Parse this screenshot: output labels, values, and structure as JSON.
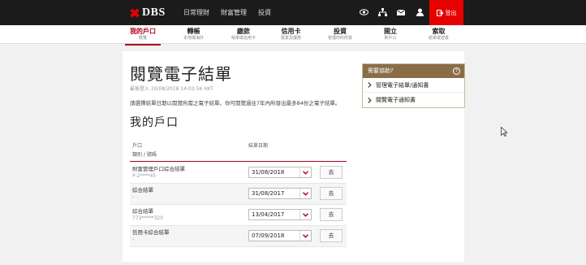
{
  "brand": "DBS",
  "topnav": [
    "日常理財",
    "財富管理",
    "投資"
  ],
  "icons": [
    "eye-icon",
    "network-icon",
    "mail-icon",
    "user-icon"
  ],
  "logout_label": "登出",
  "mainnav": [
    {
      "label": "我的戶口",
      "sub": "概覽",
      "active": true
    },
    {
      "label": "轉帳",
      "sub": "本地或海外",
      "active": false
    },
    {
      "label": "繳款",
      "sub": "賬單或信用卡",
      "active": false
    },
    {
      "label": "信用卡",
      "sub": "獎賞及優惠",
      "active": false
    },
    {
      "label": "投資",
      "sub": "管理你的財富",
      "active": false
    },
    {
      "label": "開立",
      "sub": "新戶口",
      "active": false
    },
    {
      "label": "索取",
      "sub": "結單或證書",
      "active": false
    }
  ],
  "page_title": "閱覽電子結單",
  "last_login": "最後登入 20/08/2018 14:03:56 HKT",
  "intro": "請選擇結單日期以閱覽所需之電子結單。你可閱覽過往7年內所發出最多84份之電子結單。",
  "section_title": "我的戶口",
  "columns": {
    "account": "戶口",
    "account_sub": "類別 / 號碼",
    "date": "結單日期"
  },
  "rows": [
    {
      "name": "財富管理戶口綜合結單",
      "number": "P-2****45",
      "date": "31/08/2018"
    },
    {
      "name": "綜合結單",
      "number": "-",
      "date": "31/08/2017"
    },
    {
      "name": "綜合結單",
      "number": "773*****320",
      "date": "13/04/2017"
    },
    {
      "name": "信用卡綜合結單",
      "number": "-",
      "date": "07/09/2018"
    }
  ],
  "go_label": "去",
  "help": {
    "title": "需要協助?",
    "items": [
      "管理電子結單/通知書",
      "閱覽電子通知書"
    ]
  },
  "colors": {
    "brand_red": "#e60000",
    "accent": "#b0001c",
    "help_brown": "#8a6d47"
  }
}
